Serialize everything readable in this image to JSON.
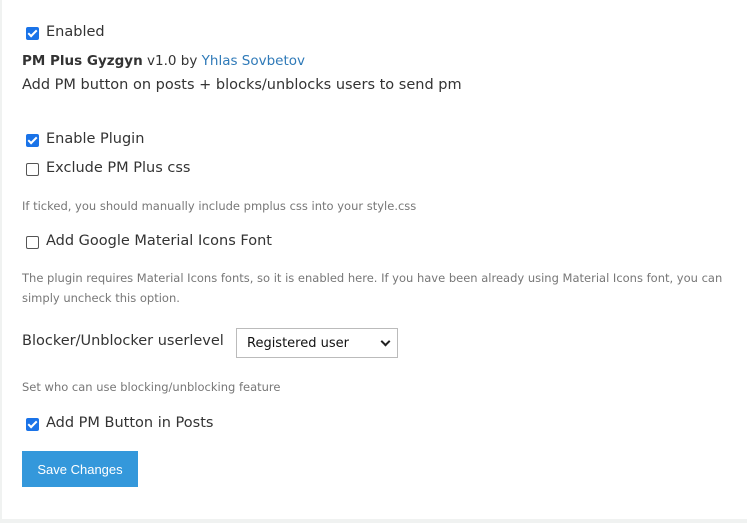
{
  "plugin": {
    "enabled_label": "Enabled",
    "enabled": true,
    "name": "PM Plus Gyzgyn",
    "version": "v1.0",
    "by": "by",
    "author": "Yhlas Sovbetov",
    "description": "Add PM button on posts + blocks/unblocks users to send pm"
  },
  "settings": {
    "enable_plugin": {
      "label": "Enable Plugin",
      "checked": true
    },
    "exclude_css": {
      "label": "Exclude PM Plus css",
      "checked": false,
      "help": "If ticked, you should manually include pmplus css into your style.css"
    },
    "material_icons": {
      "label": "Add Google Material Icons Font",
      "checked": false,
      "help_line1": "The plugin requires Material Icons fonts, so it is enabled here. If you have been already using Material Icons font, you can",
      "help_line2": "simply uncheck this option."
    },
    "userlevel": {
      "label": "Blocker/Unblocker userlevel",
      "selected": "Registered user",
      "help": "Set who can use blocking/unblocking feature"
    },
    "pm_button": {
      "label": "Add PM Button in Posts",
      "checked": true
    }
  },
  "save_label": "Save Changes",
  "colors": {
    "accent": "#3498db",
    "link": "#2f7ab8",
    "checkbox": "#1a73e8"
  }
}
